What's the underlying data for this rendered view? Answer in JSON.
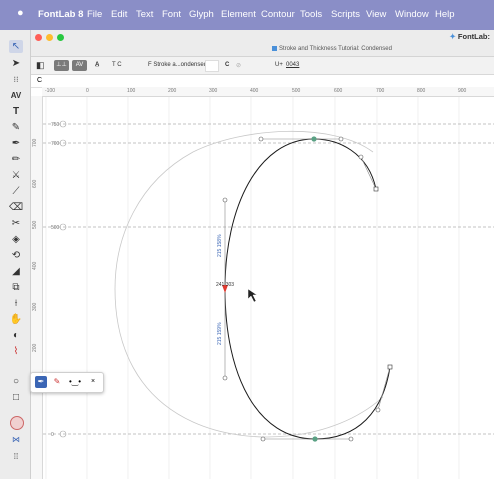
{
  "menubar": {
    "apple": "",
    "items": [
      "FontLab 8",
      "File",
      "Edit",
      "Text",
      "Font",
      "Glyph",
      "Element",
      "Contour",
      "Tools",
      "Scripts",
      "View",
      "Window",
      "Help"
    ]
  },
  "window": {
    "title": "Stroke and Thickness Tutorial: Condensed",
    "brand": "FontLab:"
  },
  "toolbar": {
    "btn1": "⊥⊥",
    "btn2": "AV",
    "kern_glyph": "T C",
    "font_name": "F Stroke a...ondensed",
    "glyph_c": "C",
    "unicode_label": "U+",
    "unicode_value": "0043"
  },
  "glyphbar": {
    "text": "C"
  },
  "ruler_h": [
    "-100",
    "0",
    "100",
    "200",
    "300",
    "400",
    "500",
    "600",
    "700",
    "800",
    "900"
  ],
  "ruler_v": [
    "700",
    "600",
    "500",
    "400",
    "300",
    "200",
    "100"
  ],
  "canvas": {
    "guides": [
      "750",
      "700",
      "500",
      "0"
    ],
    "node_readout": "241 303",
    "upper_handle_label": "215 158%",
    "lower_handle_label": "215 159%"
  },
  "colors": {
    "menubar": "#8a8ec7",
    "node_red": "#e03a2f",
    "node_green": "#5aa184",
    "guide": "#b0b0b0"
  },
  "tools": [
    "cursor-arrow",
    "contour-arrow",
    "node-select",
    "text-kerning",
    "text",
    "brush",
    "pen",
    "pencil",
    "knife",
    "rapidograph",
    "eraser-smart",
    "scissors",
    "fill",
    "rotate",
    "corner",
    "scale",
    "measure",
    "hand",
    "zoom",
    "ellipse",
    "rectangle",
    "color"
  ]
}
